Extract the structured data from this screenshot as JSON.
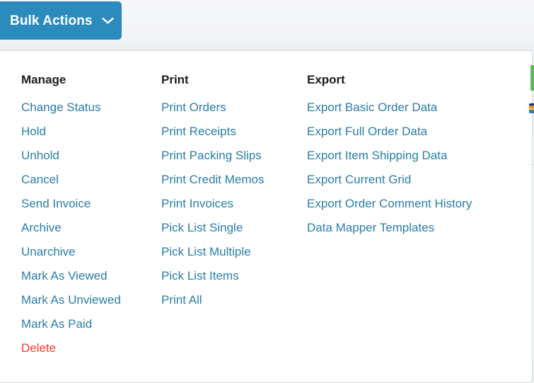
{
  "button": {
    "label": "Bulk Actions",
    "chevron_icon": "chevron-down-icon",
    "background_color": "#2c8bbd",
    "text_color": "#ffffff"
  },
  "panel": {
    "background_color": "#ffffff",
    "border_color": "#d6dade",
    "link_color": "#2a7da6",
    "heading_color": "#1c1c1c",
    "danger_color": "#e8412a"
  },
  "columns": [
    {
      "heading": "Manage",
      "items": [
        {
          "label": "Change Status",
          "style": "link"
        },
        {
          "label": "Hold",
          "style": "link"
        },
        {
          "label": "Unhold",
          "style": "link"
        },
        {
          "label": "Cancel",
          "style": "link"
        },
        {
          "label": "Send Invoice",
          "style": "link"
        },
        {
          "label": "Archive",
          "style": "link"
        },
        {
          "label": "Unarchive",
          "style": "link"
        },
        {
          "label": "Mark As Viewed",
          "style": "link"
        },
        {
          "label": "Mark As Unviewed",
          "style": "link"
        },
        {
          "label": "Mark As Paid",
          "style": "link"
        },
        {
          "label": "Delete",
          "style": "danger"
        }
      ]
    },
    {
      "heading": "Print",
      "items": [
        {
          "label": "Print Orders",
          "style": "link"
        },
        {
          "label": "Print Receipts",
          "style": "link"
        },
        {
          "label": "Print Packing Slips",
          "style": "link"
        },
        {
          "label": "Print Credit Memos",
          "style": "link"
        },
        {
          "label": "Print Invoices",
          "style": "link"
        },
        {
          "label": "Pick List Single",
          "style": "link"
        },
        {
          "label": "Pick List Multiple",
          "style": "link"
        },
        {
          "label": "Pick List Items",
          "style": "link"
        },
        {
          "label": "Print All",
          "style": "link"
        }
      ]
    },
    {
      "heading": "Export",
      "items": [
        {
          "label": "Export Basic Order Data",
          "style": "link"
        },
        {
          "label": "Export Full Order Data",
          "style": "link"
        },
        {
          "label": "Export Item Shipping Data",
          "style": "link"
        },
        {
          "label": "Export Current Grid",
          "style": "link"
        },
        {
          "label": "Export Order Comment History",
          "style": "link"
        },
        {
          "label": "Data Mapper Templates",
          "style": "link"
        }
      ]
    }
  ],
  "edge_widgets": {
    "green_bar_color": "#5cb85c",
    "chip_icon": "color-swatch-icon"
  }
}
